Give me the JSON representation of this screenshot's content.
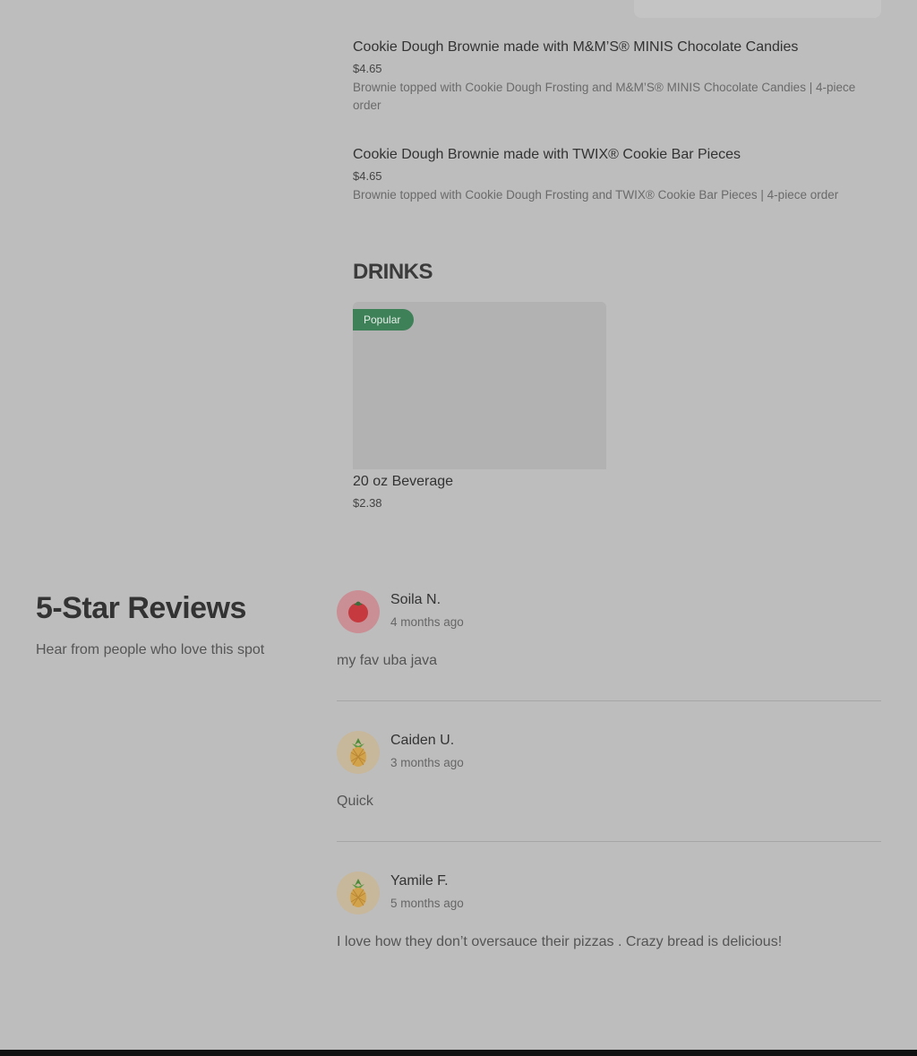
{
  "menu": {
    "items": [
      {
        "title": "Cookie Dough Brownie made with M&M’S® MINIS Chocolate Candies",
        "price": "$4.65",
        "description": "Brownie topped with Cookie Dough Frosting and M&M’S® MINIS Chocolate Candies | 4-piece order"
      },
      {
        "title": "Cookie Dough Brownie made with TWIX® Cookie Bar Pieces",
        "price": "$4.65",
        "description": "Brownie topped with Cookie Dough Frosting and TWIX® Cookie Bar Pieces | 4-piece order"
      }
    ],
    "drinks": {
      "section_title": "DRINKS",
      "items": [
        {
          "badge": "Popular",
          "title": "20 oz Beverage",
          "price": "$2.38"
        }
      ]
    }
  },
  "reviews": {
    "title": "5-Star Reviews",
    "subtitle": "Hear from people who love this spot",
    "list": [
      {
        "name": "Soila N.",
        "time": "4 months ago",
        "text": "my fav uba java",
        "avatar_icon": "tomato-icon"
      },
      {
        "name": "Caiden U.",
        "time": "3 months ago",
        "text": "Quick",
        "avatar_icon": "pineapple-icon"
      },
      {
        "name": "Yamile F.",
        "time": "5 months ago",
        "text": "I love how they don’t oversauce their pizzas . Crazy bread is delicious!",
        "avatar_icon": "pineapple-icon"
      }
    ]
  },
  "colors": {
    "overlay_background": "#bdbdbd",
    "popular_badge": "#3e8058",
    "tomato_avatar_bg": "#c98f95",
    "pineapple_avatar_bg": "#c7b79b"
  }
}
